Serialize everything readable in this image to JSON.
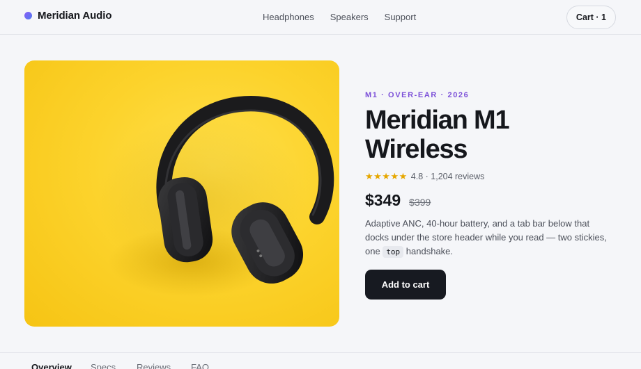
{
  "header": {
    "brand": "Meridian Audio",
    "nav": [
      "Headphones",
      "Speakers",
      "Support"
    ],
    "cart_label": "Cart · 1"
  },
  "product": {
    "eyebrow": "M1 · OVER-EAR · 2026",
    "title_line1": "Meridian M1",
    "title_line2": "Wireless",
    "stars": "★★★★★",
    "rating_text": "4.8 · 1,204 reviews",
    "price": "$349",
    "old_price": "$399",
    "desc_before": "Adaptive ANC, 40-hour battery, and a tab bar below that docks under the store header while you read — two stickies, one ",
    "desc_code": "top",
    "desc_after": " handshake.",
    "add_to_cart": "Add to cart",
    "image_icon": "headphones-photo"
  },
  "tabs": [
    "Overview",
    "Specs",
    "Reviews",
    "FAQ"
  ],
  "colors": {
    "accent": "#7b4fd8",
    "star": "#e6a700",
    "button": "#171a21",
    "image_bg": "#fcd32c"
  }
}
